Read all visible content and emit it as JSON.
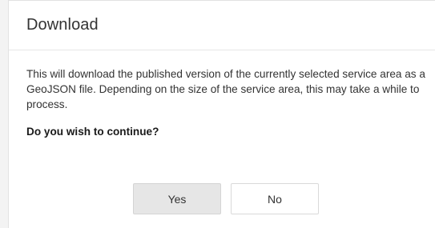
{
  "dialog": {
    "title": "Download",
    "message": "This will download the published version of the currently selected service area as a GeoJSON file. Depending on the size of the service area, this may take a while to process.",
    "question": "Do you wish to continue?",
    "buttons": {
      "yes_label": "Yes",
      "no_label": "No"
    }
  }
}
